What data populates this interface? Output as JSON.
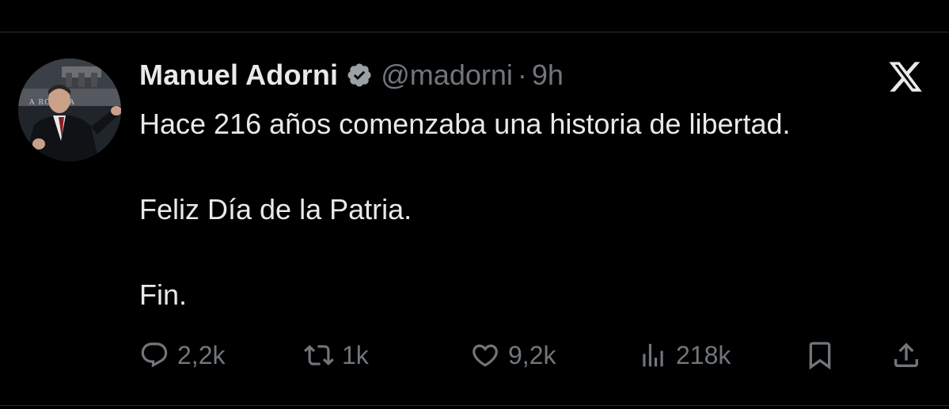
{
  "author": {
    "display_name": "Manuel Adorni",
    "handle": "@madorni",
    "separator": "·",
    "time": "9h",
    "avatar_sign_text": "A ROSADA"
  },
  "tweet": {
    "lines": [
      "Hace 216 años comenzaba una historia de libertad.",
      "Feliz Día de la Patria.",
      "Fin."
    ]
  },
  "actions": {
    "replies": "2,2k",
    "reposts": "1k",
    "likes": "9,2k",
    "views": "218k"
  },
  "icons": {
    "verified": "verified-badge-icon",
    "brand": "x-logo-icon",
    "reply": "reply-icon",
    "repost": "repost-icon",
    "like": "heart-icon",
    "views": "views-icon",
    "bookmark": "bookmark-icon",
    "share": "share-icon"
  },
  "colors": {
    "background": "#000000",
    "text_primary": "#e7e9ea",
    "text_secondary": "#71767b",
    "divider": "#2a2d30"
  }
}
